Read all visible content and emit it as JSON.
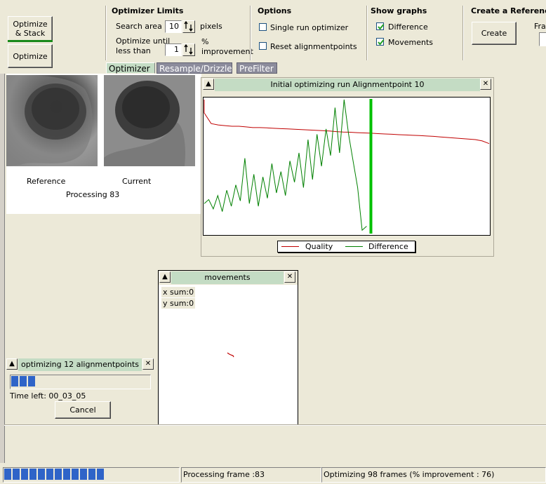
{
  "left_buttons": {
    "optimize_stack": "Optimize & Stack",
    "optimize": "Optimize"
  },
  "optimizer_limits": {
    "title": "Optimizer Limits",
    "search_area_label": "Search area",
    "search_area_value": "10",
    "search_area_unit": "pixels",
    "optimize_until_label_1": "Optimize until",
    "optimize_until_label_2": "less than",
    "optimize_until_value": "1",
    "optimize_until_unit_1": "%",
    "optimize_until_unit_2": "improvement"
  },
  "options": {
    "title": "Options",
    "single_run": {
      "label": "Single run optimizer",
      "checked": false
    },
    "reset_alignment": {
      "label": "Reset alignmentpoints",
      "checked": false
    }
  },
  "show_graphs": {
    "title": "Show graphs",
    "difference": {
      "label": "Difference",
      "checked": true
    },
    "movements": {
      "label": "Movements",
      "checked": true
    }
  },
  "reference": {
    "title": "Create a Reference",
    "create_button": "Create",
    "frames_label": "Fra"
  },
  "tabs": [
    {
      "label": "Optimizer",
      "active": true
    },
    {
      "label": "Resample/Drizzle",
      "active": false
    },
    {
      "label": "PreFilter",
      "active": false
    }
  ],
  "images": {
    "reference_label": "Reference",
    "current_label": "Current",
    "processing_text": "Processing 83"
  },
  "graph_window": {
    "title": "Initial optimizing run Alignmentpoint 10",
    "legend": [
      {
        "name": "Quality",
        "color": "#c00000"
      },
      {
        "name": "Difference",
        "color": "#008000"
      }
    ]
  },
  "chart_data": {
    "type": "line",
    "title": "Initial optimizing run Alignmentpoint 10",
    "xlabel": "",
    "ylabel": "",
    "grid": false,
    "legend": "bottom",
    "series": [
      {
        "name": "Quality",
        "color": "#c00000",
        "values": [
          0.1,
          0.18,
          0.19,
          0.195,
          0.2,
          0.2,
          0.205,
          0.21,
          0.21,
          0.212,
          0.215,
          0.218,
          0.22,
          0.222,
          0.225,
          0.228,
          0.23,
          0.233,
          0.236,
          0.24,
          0.243,
          0.245,
          0.248,
          0.25,
          0.252,
          0.255,
          0.258,
          0.26,
          0.263,
          0.265,
          0.268,
          0.27,
          0.273,
          0.276,
          0.28,
          0.284,
          0.288,
          0.292,
          0.296,
          0.3,
          0.31,
          0.33
        ]
      },
      {
        "name": "Difference",
        "color": "#008000",
        "values": [
          0.78,
          0.75,
          0.82,
          0.72,
          0.84,
          0.68,
          0.8,
          0.64,
          0.76,
          0.44,
          0.78,
          0.56,
          0.8,
          0.58,
          0.74,
          0.48,
          0.7,
          0.54,
          0.72,
          0.46,
          0.62,
          0.4,
          0.66,
          0.3,
          0.6,
          0.26,
          0.5,
          0.22,
          0.42,
          0.06,
          0.4,
          0.0,
          0.26,
          0.46,
          0.66,
          0.98,
          0.95
        ]
      }
    ],
    "marker_position": 0.58
  },
  "movements_window": {
    "title": "movements",
    "x_sum": "x sum:0",
    "y_sum": "y sum:0"
  },
  "progress_window": {
    "title": "optimizing 12 alignmentpoints",
    "progress": 0.2,
    "time_left": "Time left: 00_03_05",
    "cancel_button": "Cancel"
  },
  "status_bar": {
    "progress": 0.58,
    "frame_text": "Processing frame :83",
    "optimizing_text": "Optimizing 98 frames (% improvement : 76)"
  }
}
